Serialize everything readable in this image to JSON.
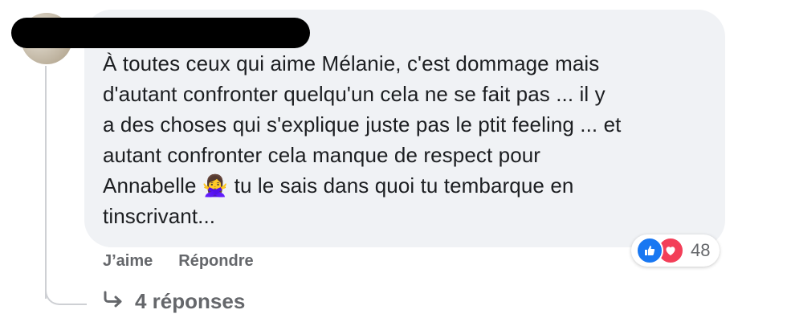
{
  "comment": {
    "author_redacted": true,
    "text": "À toutes ceux qui aime Mélanie, c'est dommage mais\nd'autant confronter quelqu'un cela ne se fait pas ... il y\na des choses qui s'explique juste pas le ptit feeling ... et\nautant confronter cela manque de respect pour\nAnnabelle 🙅‍♀️ tu le sais dans quoi tu tembarque en\ntinscrivant..."
  },
  "actions": {
    "like_label": "J’aime",
    "reply_label": "Répondre"
  },
  "reactions": {
    "icons": [
      "like-icon",
      "love-icon"
    ],
    "count": "48",
    "colors": {
      "like": "#1877f2",
      "love": "#f33e58"
    }
  },
  "replies": {
    "label": "4 réponses",
    "icon": "reply-arrow-icon"
  }
}
